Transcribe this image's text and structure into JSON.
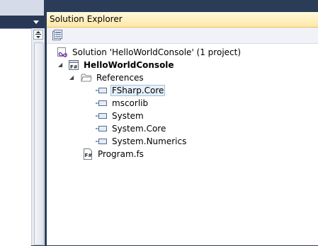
{
  "left_pane": {
    "dropdown_icon": "dropdown-arrow-icon",
    "split_icon": "splitter-icon"
  },
  "solution_explorer": {
    "title": "Solution Explorer",
    "toolbar": {
      "properties_icon": "properties-icon"
    },
    "tree": {
      "solution": {
        "label": "Solution 'HelloWorldConsole' (1 project)",
        "icon": "solution-icon"
      },
      "project": {
        "label": "HelloWorldConsole",
        "icon": "fsharp-project-icon",
        "expanded": true
      },
      "references": {
        "label": "References",
        "icon": "folder-icon",
        "expanded": true,
        "items": [
          {
            "label": "FSharp.Core",
            "icon": "assembly-reference-icon",
            "selected": true
          },
          {
            "label": "mscorlib",
            "icon": "assembly-reference-icon"
          },
          {
            "label": "System",
            "icon": "assembly-reference-icon"
          },
          {
            "label": "System.Core",
            "icon": "assembly-reference-icon"
          },
          {
            "label": "System.Numerics",
            "icon": "assembly-reference-icon"
          }
        ]
      },
      "file": {
        "label": "Program.fs",
        "icon": "fsharp-file-icon"
      }
    }
  },
  "colors": {
    "chrome_background": "#2b3c59",
    "header_gradient_top": "#fff9dd",
    "header_gradient_bottom": "#ffe8a6",
    "selection_border": "#9ec1e4",
    "selection_fill": "#e6f0fa"
  }
}
